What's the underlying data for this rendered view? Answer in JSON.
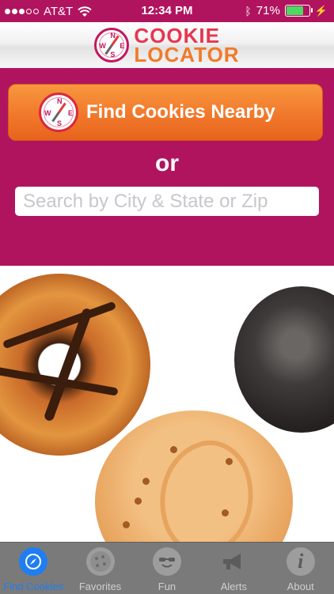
{
  "status_bar": {
    "carrier": "AT&T",
    "time": "12:34 PM",
    "battery": "71%"
  },
  "header": {
    "logo_line1": "COOKIE",
    "logo_line2": "LOCATOR",
    "compass_letters": {
      "n": "N",
      "s": "S",
      "e": "E",
      "w": "W"
    }
  },
  "main": {
    "find_button_label": "Find Cookies Nearby",
    "or_text": "or",
    "search_placeholder": "Search by City & State or Zip"
  },
  "tabs": [
    {
      "label": "Find Cookies",
      "icon": "compass-icon",
      "active": true
    },
    {
      "label": "Favorites",
      "icon": "cookie-icon",
      "active": false
    },
    {
      "label": "Fun",
      "icon": "sunglasses-smiley-icon",
      "active": false
    },
    {
      "label": "Alerts",
      "icon": "megaphone-icon",
      "active": false
    },
    {
      "label": "About",
      "icon": "info-icon",
      "active": false
    }
  ],
  "colors": {
    "magenta": "#b0145f",
    "orange_button": "#f27b2d",
    "tab_active": "#1e7ef2",
    "battery_green": "#4cd964"
  }
}
